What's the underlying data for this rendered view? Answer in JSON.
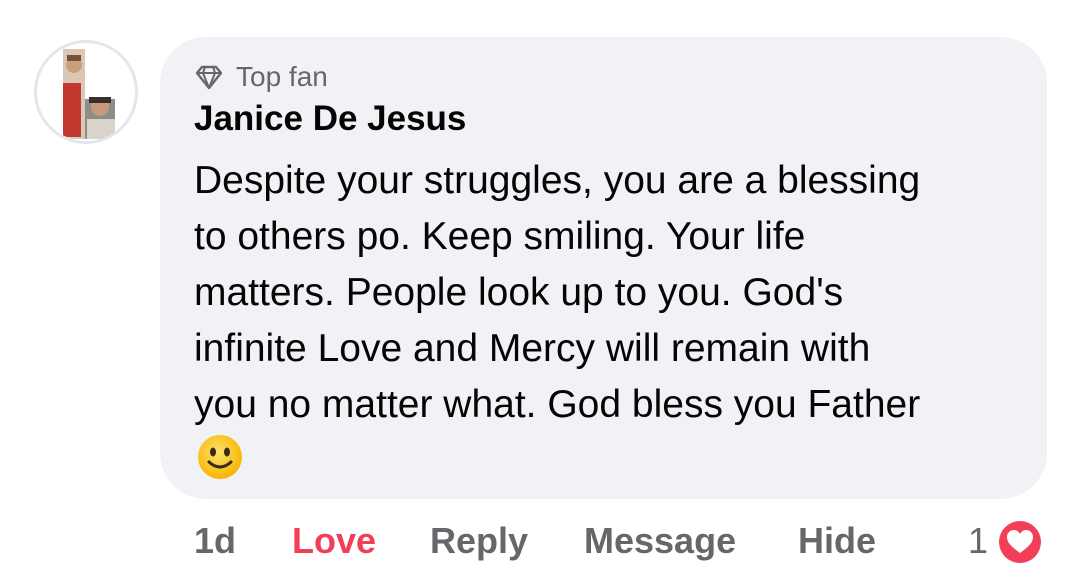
{
  "comment": {
    "badge_label": "Top fan",
    "badge_icon": "diamond-icon",
    "author": "Janice De Jesus",
    "text_lines": [
      "Despite your struggles, you are a blessing",
      "to others po. Keep smiling. Your life",
      "matters. People look up to you. God's",
      "infinite Love and Mercy will remain with",
      "you no matter what. God bless you Father"
    ],
    "emoji": "slightly-smiling-face-emoji"
  },
  "actions": {
    "time": "1d",
    "love": "Love",
    "reply": "Reply",
    "message": "Message",
    "hide": "Hide",
    "reaction_count": "1",
    "reaction_icon": "heart-reaction-icon"
  },
  "colors": {
    "bubble": "#f0f2f5",
    "love": "#f33e58",
    "secondary_text": "#65676b",
    "primary_text": "#050505"
  }
}
